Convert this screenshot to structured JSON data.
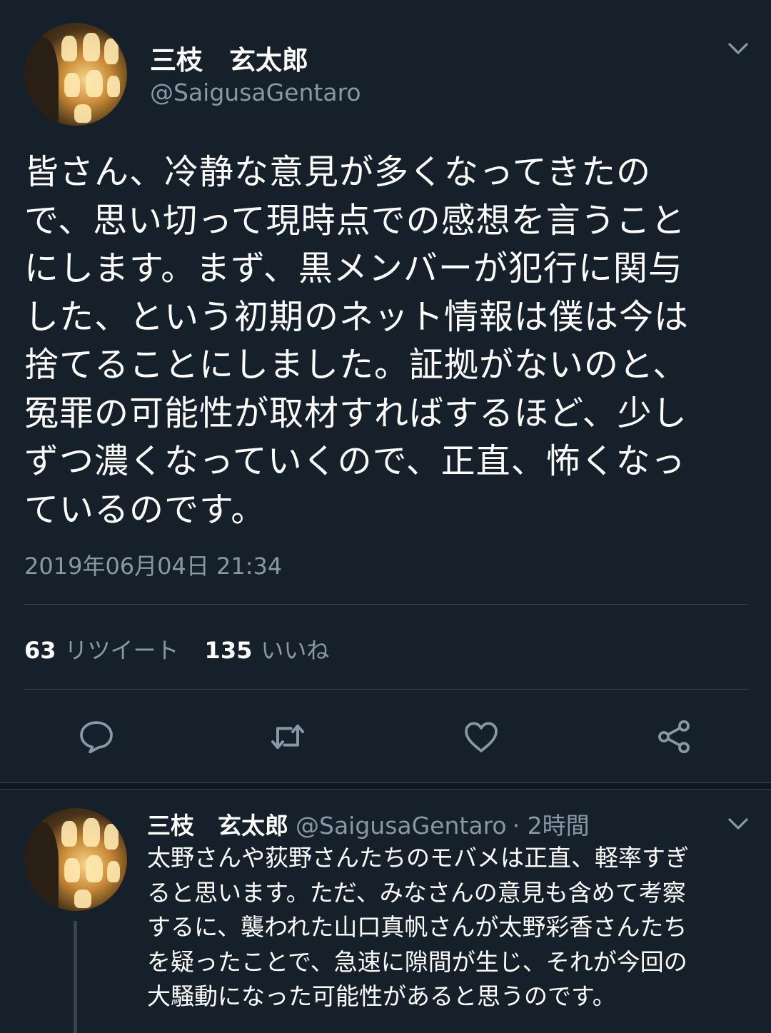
{
  "main_tweet": {
    "author_name": "三枝　玄太郎",
    "author_handle": "@SaigusaGentaro",
    "text_lines": [
      "皆さん、冷静な意見が多くなってきたの",
      "で、思い切って現時点での感想を言うこと",
      "にします。まず、黒メンバーが犯行に関与",
      "した、という初期のネット情報は僕は今は",
      "捨てることにしました。証拠がないのと、",
      "冤罪の可能性が取材すればするほど、少し",
      "ずつ濃くなっていくので、正直、怖くなっ",
      "ているのです。"
    ],
    "timestamp": "2019年06月04日 21:34",
    "retweet_count": "63",
    "retweet_label": "リツイート",
    "like_count": "135",
    "like_label": "いいね",
    "actions": [
      "reply-icon",
      "retweet-icon",
      "like-icon",
      "share-icon"
    ]
  },
  "reply_tweet": {
    "author_name": "三枝　玄太郎",
    "author_handle": "@SaigusaGentaro",
    "meta": "· 2時間",
    "text_lines": [
      "太野さんや荻野さんたちのモバメは正直、軽率すぎ",
      "ると思います。ただ、みなさんの意見も含めて考察",
      "するに、襲われた山口真帆さんが太野彩香さんたち",
      "を疑ったことで、急速に隙間が生じ、それが今回の",
      "大騒動になった可能性があると思うのです。"
    ]
  },
  "colors": {
    "background": "#15202b",
    "secondary_text": "#8899a6",
    "divider": "#38444d",
    "primary_text": "#ffffff"
  }
}
